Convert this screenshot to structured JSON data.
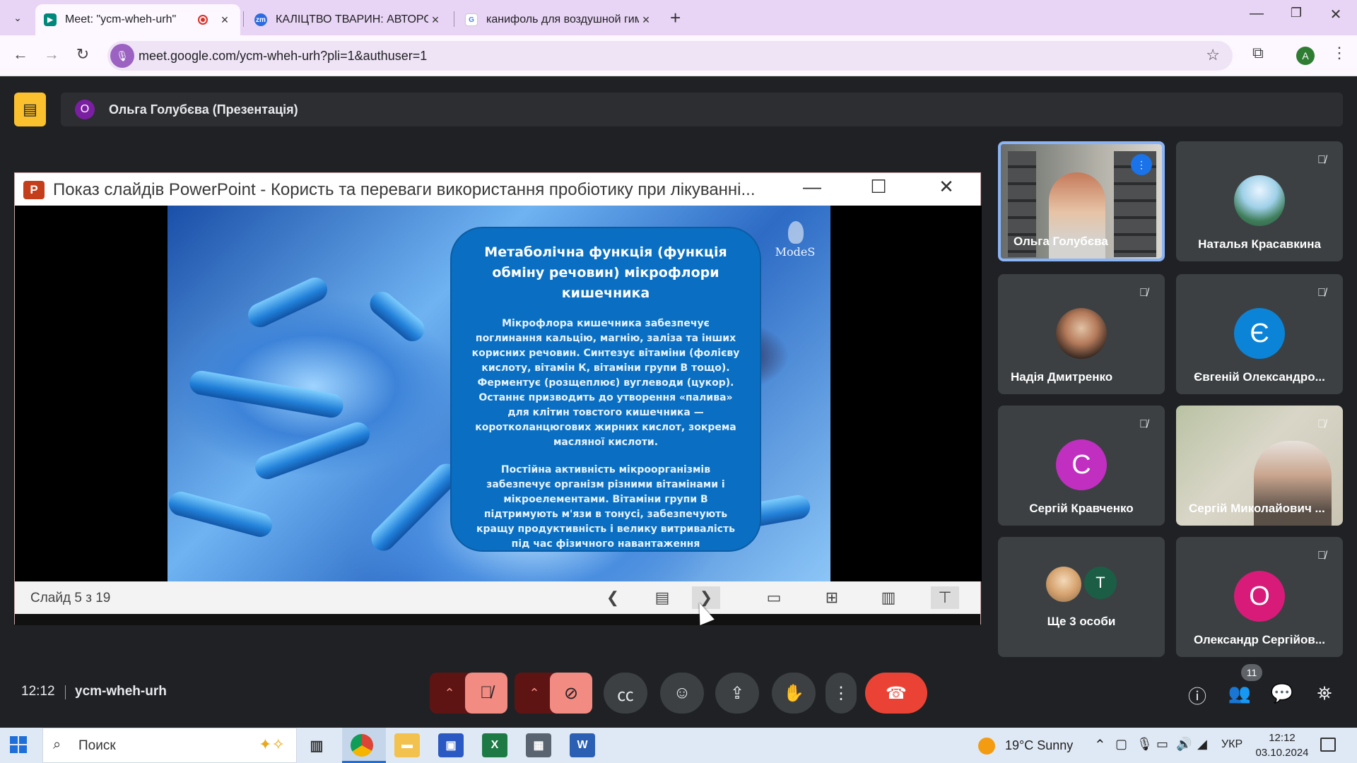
{
  "browser": {
    "tabs": [
      {
        "title": "Meet: \"ycm-wheh-urh\"",
        "active": true,
        "favicon": "google-meet-icon"
      },
      {
        "title": "КАЛІЦТВО ТВАРИН: АВТОРСЬКИЙ",
        "active": false,
        "favicon": "zoom-icon"
      },
      {
        "title": "канифоль для воздушной гимнастики",
        "active": false,
        "favicon": "google-icon"
      }
    ],
    "url": "meet.google.com/ycm-wheh-urh?pli=1&authuser=1",
    "profile_initial": "A"
  },
  "meet": {
    "presenter_initial": "О",
    "presenter_label": "Ольга Голубєва (Презентація)",
    "time": "12:12",
    "meeting_code": "ycm-wheh-urh",
    "participants_count": "11",
    "participants": [
      {
        "name": "Ольга Голубєва",
        "speaking": true
      },
      {
        "name": "Наталья Красавкина",
        "muted": true
      },
      {
        "name": "Надія Дмитренко",
        "muted": true
      },
      {
        "name": "Євгеній Олександро...",
        "initial": "Є",
        "color": "#0b84d8",
        "muted": true
      },
      {
        "name": "Сергій Кравченко",
        "initial": "С",
        "color": "#c12fc1",
        "muted": true
      },
      {
        "name": "Сергій Миколайович ...",
        "muted": true
      },
      {
        "name": "Ще 3 особи",
        "initial": "T",
        "color": "#1b5e45"
      },
      {
        "name": "Олександр Сергійов...",
        "initial": "О",
        "color": "#d81b79",
        "muted": true
      }
    ]
  },
  "ppt": {
    "window_title": "Показ слайдів PowerPoint  -  Користь та переваги використання пробіотику при лікуванні...",
    "slide_counter": "Слайд 5 з 19",
    "slide": {
      "logo_text": "ModeS",
      "heading": "Метаболічна функція (функція обміну речовин) мікрофлори кишечника",
      "para1": "Мікрофлора кишечника забезпечує поглинання кальцію, магнію, заліза та інших корисних речовин. Синтезує вітаміни (фолієву кислоту, вітамін К, вітаміни групи В тощо). Ферментує (розщеплює) вуглеводи (цукор). Останнє призводить до утворення «палива» для клітин товстого кишечника — коротколанцюгових жирних кислот, зокрема масляної кислоти.",
      "para2": "Постійна активність мікроорганізмів забезпечує організм різними вітамінами і мікроелементами. Вітаміни групи В підтримують м'язи в тонусі, забезпечують кращу продуктивність і велику витривалість під час фізичного навантаження"
    }
  },
  "taskbar": {
    "search_placeholder": "Поиск",
    "weather": "19°C  Sunny",
    "lang": "УКР",
    "clock_time": "12:12",
    "clock_date": "03.10.2024"
  }
}
